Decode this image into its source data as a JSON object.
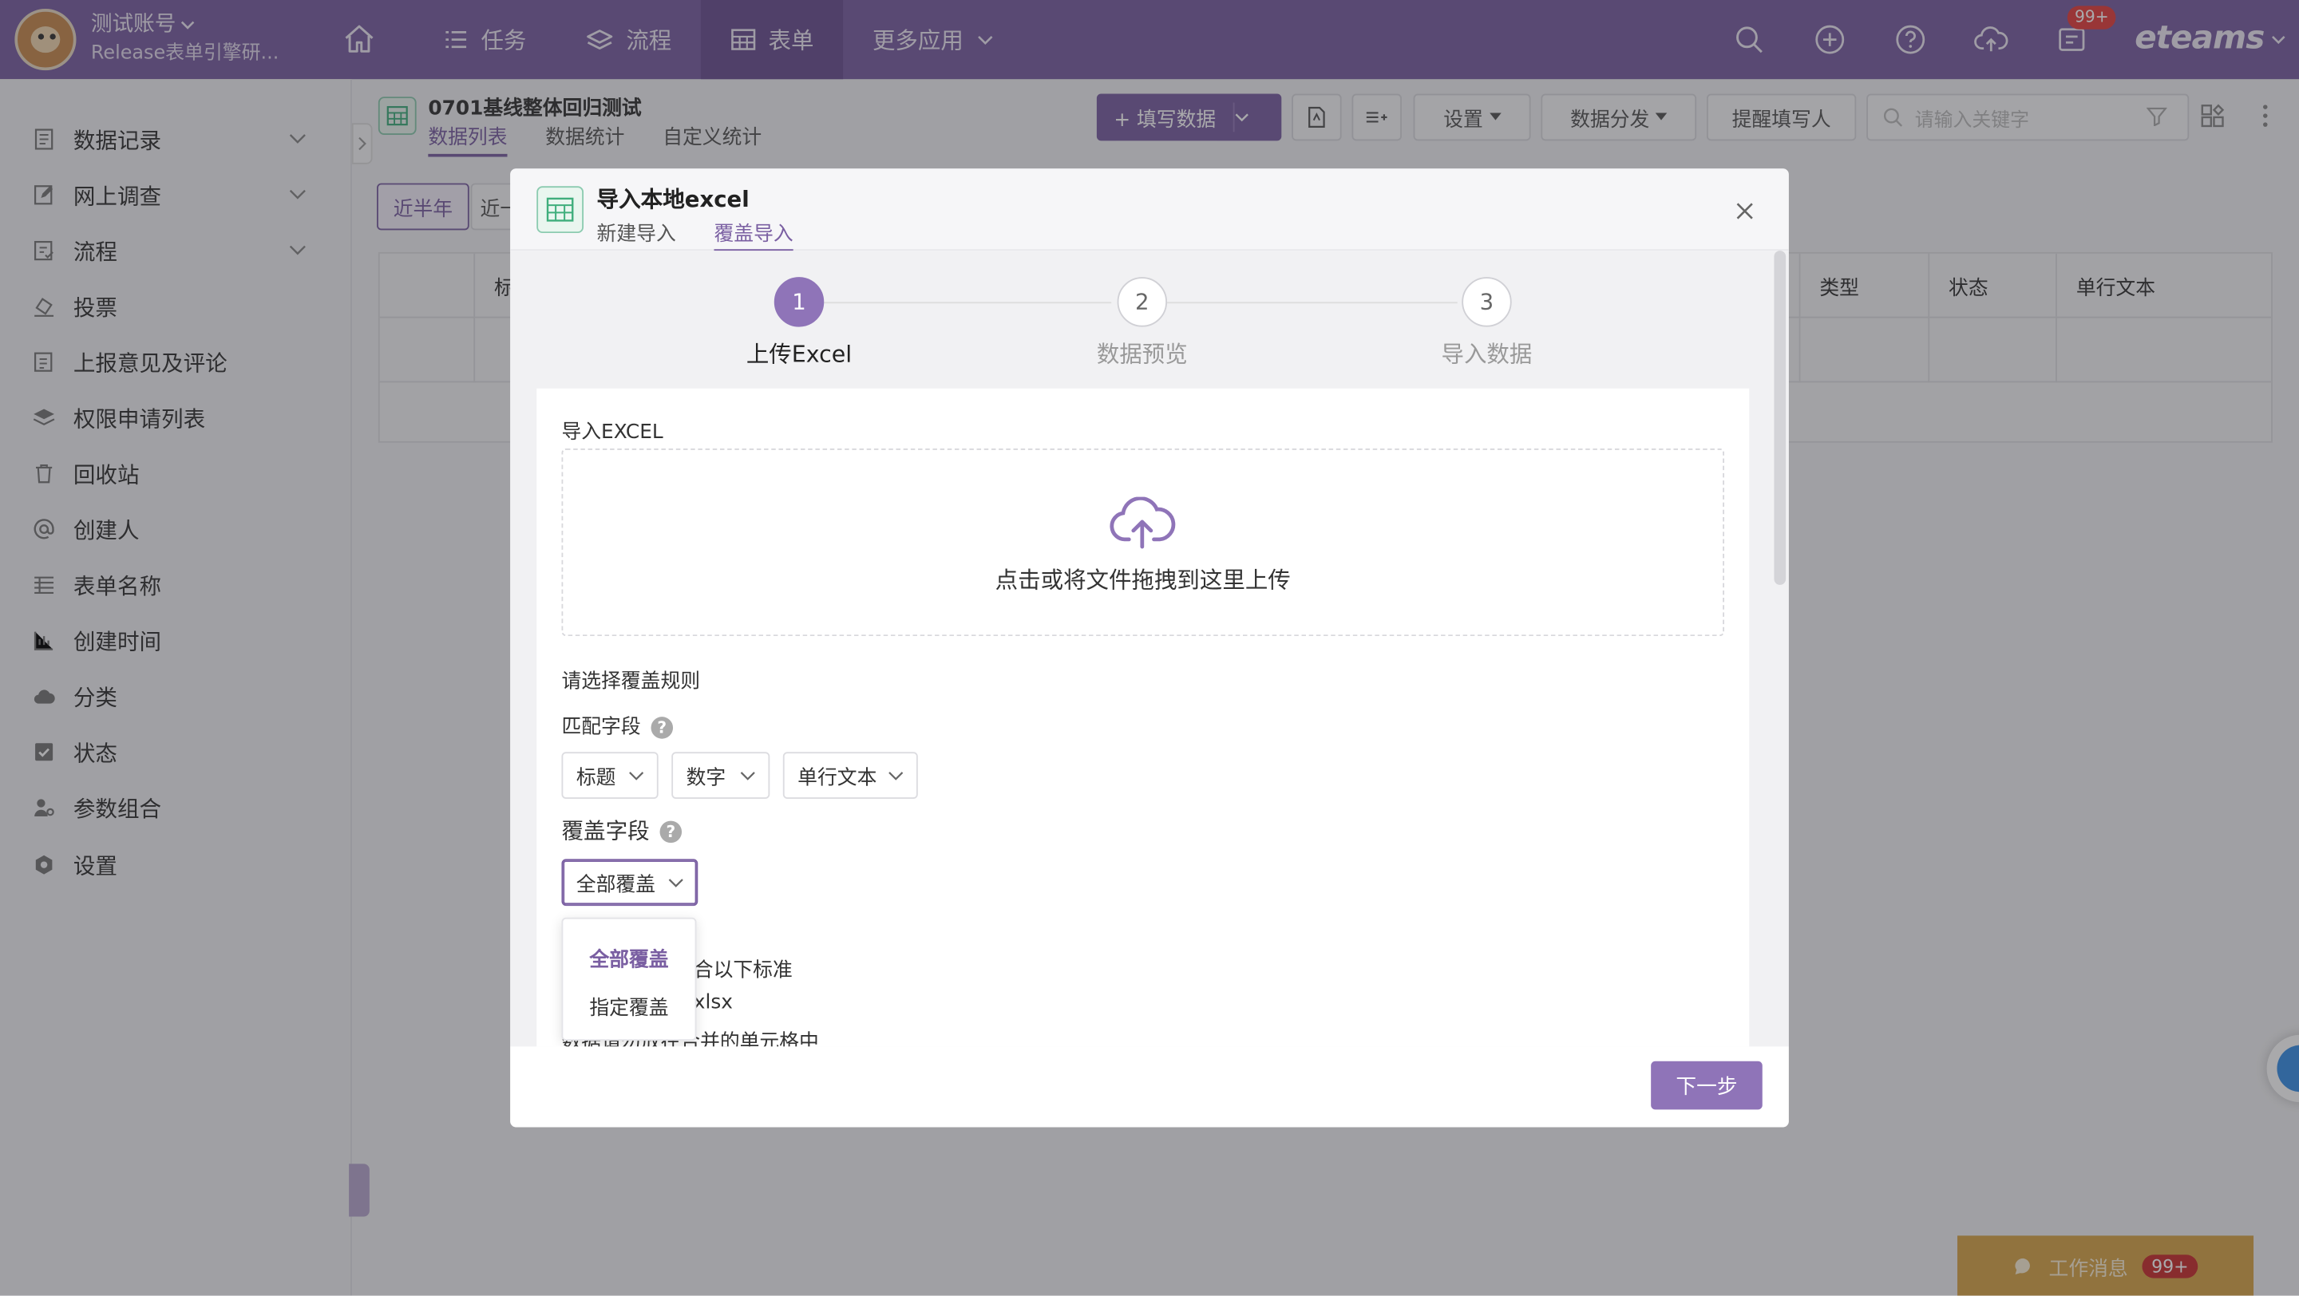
{
  "header": {
    "account_name": "测试账号",
    "account_sub": "Release表单引擎研...",
    "nav": [
      {
        "label": "任务",
        "icon": "list-icon"
      },
      {
        "label": "流程",
        "icon": "layers-icon"
      },
      {
        "label": "表单",
        "icon": "table-icon"
      },
      {
        "label": "更多应用",
        "icon": "chevron-down-icon"
      }
    ],
    "notify_badge": "99+",
    "brand": "eteams"
  },
  "sidebar": {
    "items": [
      {
        "label": "数据记录"
      },
      {
        "label": "网上调查"
      },
      {
        "label": "流程"
      },
      {
        "label": "投票"
      },
      {
        "label": "上报意见及评论"
      },
      {
        "label": "权限申请列表"
      },
      {
        "label": "回收站"
      },
      {
        "label": "创建人"
      },
      {
        "label": "表单名称"
      },
      {
        "label": "创建时间"
      },
      {
        "label": "分类"
      },
      {
        "label": "状态"
      },
      {
        "label": "参数组合"
      },
      {
        "label": "设置"
      }
    ]
  },
  "page": {
    "title": "0701基线整体回归测试",
    "tabs": [
      "数据列表",
      "数据统计",
      "自定义统计"
    ],
    "fill_button": "+ 填写数据",
    "settings": "设置",
    "distribute": "数据分发",
    "remind": "提醒填写人",
    "search_placeholder": "请输入关键字",
    "chips": [
      "近半年",
      "近一"
    ],
    "table_headers": [
      "标",
      "类型",
      "状态",
      "单行文本"
    ]
  },
  "modal": {
    "title": "导入本地excel",
    "tabs": [
      "新建导入",
      "覆盖导入"
    ],
    "steps": [
      {
        "num": "1",
        "label": "上传Excel"
      },
      {
        "num": "2",
        "label": "数据预览"
      },
      {
        "num": "3",
        "label": "导入数据"
      }
    ],
    "import_label": "导入EXCEL",
    "upload_text": "点击或将文件拖拽到这里上传",
    "rule_label": "请选择覆盖规则",
    "match_label": "匹配字段",
    "match_fields": [
      "标题",
      "数字",
      "单行文本"
    ],
    "cover_label": "覆盖字段",
    "cover_value": "全部覆盖",
    "dropdown_options": [
      "全部覆盖",
      "指定覆盖"
    ],
    "note_1": "合以下标准",
    "note_2": "xlsx",
    "note_3": "数据请勿放在合并的单元格中",
    "next_button": "下一步"
  },
  "footer": {
    "work_msg": "工作消息",
    "work_badge": "99+"
  },
  "colors": {
    "primary": "#7a5fa2",
    "accent": "#8f74b8",
    "badge": "#e5403f",
    "work_bar": "#d8a54a"
  }
}
